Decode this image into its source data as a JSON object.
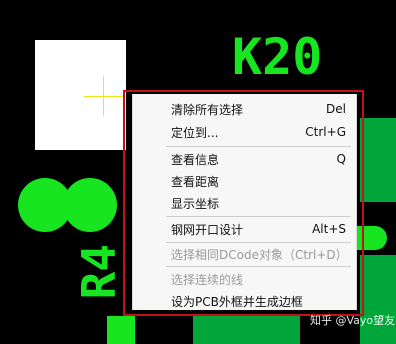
{
  "canvas_labels": {
    "top_right": "K20",
    "bottom_left": "R4"
  },
  "context_menu": {
    "items": [
      {
        "label": "清除所有选择",
        "shortcut": "Del",
        "disabled": false
      },
      {
        "label": "定位到...",
        "shortcut": "Ctrl+G",
        "disabled": false
      },
      {
        "label": "查看信息",
        "shortcut": "Q",
        "disabled": false
      },
      {
        "label": "查看距离",
        "shortcut": "",
        "disabled": false
      },
      {
        "label": "显示坐标",
        "shortcut": "",
        "disabled": false
      },
      {
        "label": "钢网开口设计",
        "shortcut": "Alt+S",
        "disabled": false
      },
      {
        "label": "选择相同DCode对象（Ctrl+D）",
        "shortcut": "",
        "disabled": true
      },
      {
        "label": "选择连续的线",
        "shortcut": "",
        "disabled": true
      },
      {
        "label": "设为PCB外框并生成边框",
        "shortcut": "",
        "disabled": false
      }
    ]
  },
  "watermark": {
    "text": "知乎 @Vayo望友"
  }
}
